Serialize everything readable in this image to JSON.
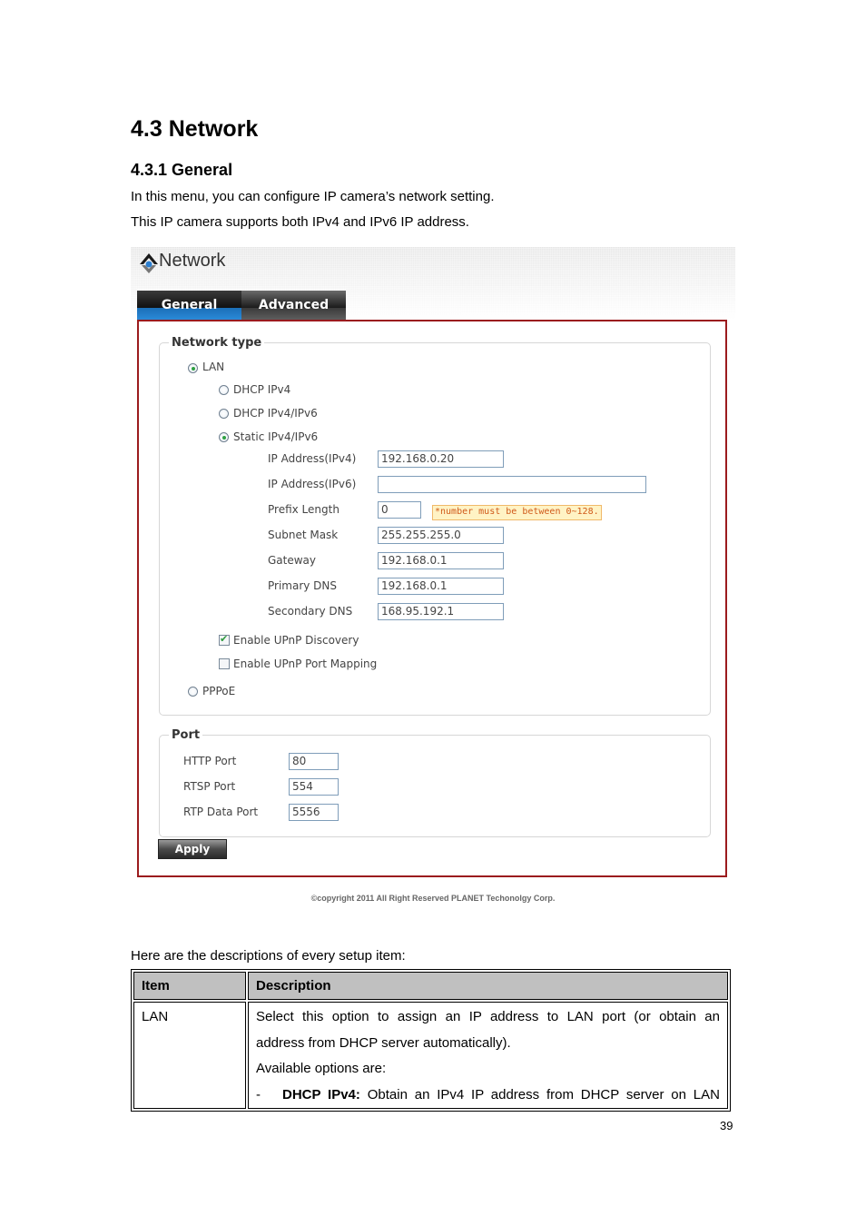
{
  "document": {
    "heading1": "4.3 Network",
    "heading2": "4.3.1 General",
    "intro_lines": [
      "In this menu, you can configure IP camera’s network setting.",
      "This IP camera supports both IPv4 and IPv6 IP address."
    ],
    "table_intro": "Here are the descriptions of every setup item:",
    "page_number": "39"
  },
  "screenshot": {
    "title": "Network",
    "logo_icon": "planet-logo-icon",
    "tabs": [
      {
        "label": "General",
        "active": true
      },
      {
        "label": "Advanced",
        "active": false
      }
    ],
    "network_type": {
      "legend": "Network type",
      "lan": {
        "label": "LAN",
        "selected": true
      },
      "lan_options": [
        {
          "label": "DHCP IPv4",
          "selected": false
        },
        {
          "label": "DHCP IPv4/IPv6",
          "selected": false
        },
        {
          "label": "Static IPv4/IPv6",
          "selected": true
        }
      ],
      "fields": [
        {
          "label": "IP Address(IPv4)",
          "value": "192.168.0.20"
        },
        {
          "label": "IP Address(IPv6)",
          "value": ""
        },
        {
          "label": "Prefix Length",
          "value": "0"
        },
        {
          "label": "Subnet Mask",
          "value": "255.255.255.0"
        },
        {
          "label": "Gateway",
          "value": "192.168.0.1"
        },
        {
          "label": "Primary DNS",
          "value": "192.168.0.1"
        },
        {
          "label": "Secondary DNS",
          "value": "168.95.192.1"
        }
      ],
      "prefix_warning": "*number must be between 0~128.",
      "upnp_discovery": {
        "label": "Enable UPnP Discovery",
        "checked": true
      },
      "upnp_port_mapping": {
        "label": "Enable UPnP Port Mapping",
        "checked": false
      },
      "pppoe": {
        "label": "PPPoE",
        "selected": false
      }
    },
    "port": {
      "legend": "Port",
      "fields": [
        {
          "label": "HTTP Port",
          "value": "80"
        },
        {
          "label": "RTSP Port",
          "value": "554"
        },
        {
          "label": "RTP Data Port",
          "value": "5556"
        }
      ]
    },
    "apply_label": "Apply",
    "copyright": "©copyright 2011 All Right Reserved PLANET Techonolgy Corp.",
    "colors": {
      "panel_border": "#9b1b1e",
      "active_tab": "#1b6fb8",
      "warning_text": "#d05a1a",
      "warning_bg": "#fff3c4"
    }
  },
  "table": {
    "headers": [
      "Item",
      "Description"
    ],
    "rows": [
      {
        "item": "LAN",
        "description_lines": [
          "Select this option to assign an IP address to LAN port (or obtain an",
          "address from DHCP server automatically).",
          "Available options are:"
        ],
        "bullet": {
          "dash": "-",
          "bold": "DHCP IPv4:",
          "text": " Obtain an IPv4 IP address from DHCP server on LAN"
        }
      }
    ]
  }
}
